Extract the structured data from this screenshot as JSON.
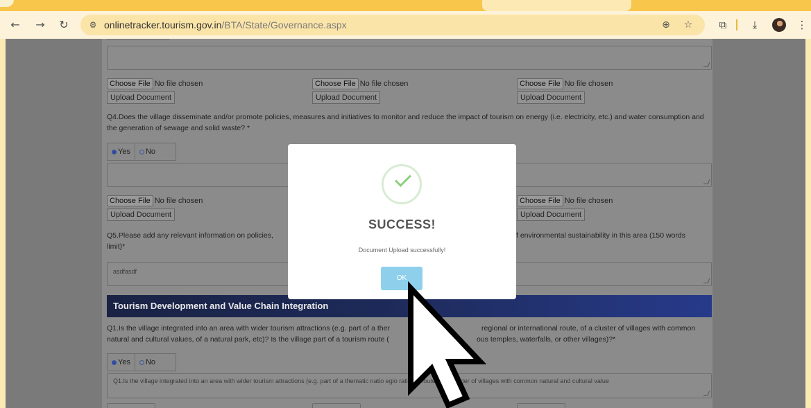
{
  "browser": {
    "url_host": "onlinetracker.tourism.gov.in",
    "url_path": "/BTA/State/Governance.aspx",
    "icons": {
      "back": "back-arrow-icon",
      "forward": "forward-arrow-icon",
      "reload": "reload-icon",
      "site_info": "tune-icon",
      "zoom": "zoom-icon",
      "bookmark": "star-icon",
      "extensions": "puzzle-icon",
      "download": "download-icon",
      "menu": "kebab-menu-icon"
    }
  },
  "form": {
    "file_choose_label": "Choose File",
    "file_none_label": "No file chosen",
    "upload_label": "Upload Document",
    "q4_text": "Q4.Does the village disseminate and/or promote policies, measures and initiatives to monitor and reduce the impact of tourism on energy (i.e. electricity, etc.) and water consumption and the generation of sewage and solid waste? *",
    "yes_label": "Yes",
    "no_label": "No",
    "q5_text_left": "Q5.Please add any relevant information on policies,",
    "q5_text_right": "f environmental sustainability in this area (150 words",
    "q5_text_line2": "limit)*",
    "q5_answer": "asdfasdf",
    "section_title": "Tourism Development and Value Chain Integration",
    "q1_line1_a": "Q1.Is the village integrated into an area with wider tourism attractions (e.g. part of a ther",
    "q1_line1_b": "regional or international route, of a cluster of villages with common",
    "q1_line2_a": "natural and cultural values, of a natural park, etc)? Is the village part of a tourism route (",
    "q1_line2_b": "ous temples, waterfalls, or other villages)?*",
    "q1_answer": "Q1.Is the village integrated into an area with wider tourism attractions (e.g. part of a thematic natio   egio       rational route, of a cluster of villages with common natural and cultural value"
  },
  "modal": {
    "title": "SUCCESS!",
    "message": "Document Upload successfully!",
    "ok_label": "OK",
    "icon": "check-circle-icon",
    "accent": "#8fcf7e",
    "button_color": "#8ed0ec"
  },
  "colors": {
    "tabstrip": "#f7c64a",
    "toolbar": "#fdf3da",
    "section_header": "#1d2a58"
  }
}
